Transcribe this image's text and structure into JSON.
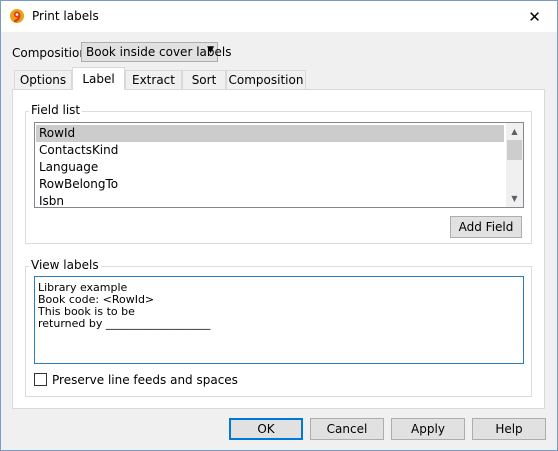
{
  "window": {
    "title": "Print labels"
  },
  "composition": {
    "label": "Composition:",
    "selected": "Book inside cover labels"
  },
  "tabs": [
    {
      "label": "Options"
    },
    {
      "label": "Label"
    },
    {
      "label": "Extract"
    },
    {
      "label": "Sort"
    },
    {
      "label": "Composition"
    }
  ],
  "active_tab": "Label",
  "field_list": {
    "caption": "Field list",
    "items": [
      "RowId",
      "ContactsKind",
      "Language",
      "RowBelongTo",
      "Isbn"
    ],
    "selected": "RowId",
    "add_button": "Add Field"
  },
  "view_labels": {
    "caption": "View labels",
    "lines": [
      "Library example",
      "Book code: <RowId>",
      "This book is to be",
      "returned by ___________________"
    ]
  },
  "preserve": {
    "label": "Preserve line feeds and spaces",
    "checked": false
  },
  "buttons": {
    "ok": "OK",
    "cancel": "Cancel",
    "apply": "Apply",
    "help": "Help"
  },
  "colors": {
    "accent": "#0078d7",
    "selection": "#cccccc",
    "textarea_border": "#2d7bb8"
  }
}
